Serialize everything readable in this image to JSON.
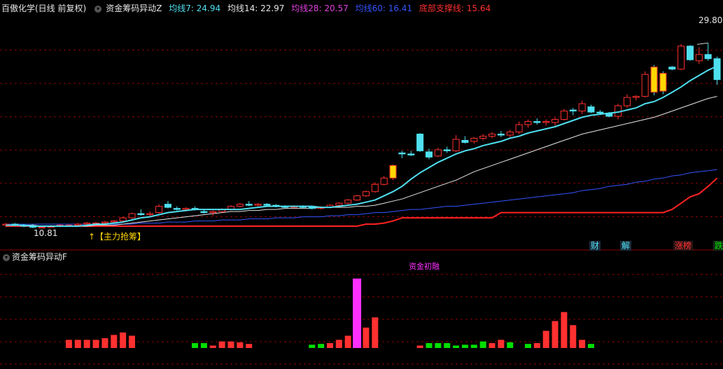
{
  "main_header": {
    "stock": "百傲化学(日线 前复权)",
    "indicator": "资金筹码异动Z",
    "ma7": "均线7: 24.94",
    "ma14": "均线14: 22.97",
    "ma28": "均线28: 20.57",
    "ma60": "均线60: 16.41",
    "support": "底部支撑线: 15.64"
  },
  "sub_header": {
    "indicator": "资金筹码异动F"
  },
  "annotations": {
    "high": "29.80",
    "low": "10.81",
    "main_force": "↑【主力抢筹】",
    "sub_label": "资金初融"
  },
  "tags": [
    "财",
    "解",
    "涨榜",
    "跌"
  ],
  "colors": {
    "ma7": "#4fe0f0",
    "ma14": "#e6e6e6",
    "ma28": "#e040e0",
    "ma60": "#3355ff",
    "support": "#ff2222",
    "up": "#ff3030",
    "down": "#4fe0f0",
    "signal": "#ffd700",
    "green": "#00e000",
    "magenta": "#ff30ff",
    "grid": "#8b0000"
  },
  "chart_data": {
    "type": "candlestick",
    "main_y_range": [
      10.0,
      31.0
    ],
    "candles": [
      [
        11.1,
        11.3,
        10.9,
        11.2
      ],
      [
        11.2,
        11.3,
        11.0,
        11.1
      ],
      [
        11.1,
        11.2,
        10.9,
        11.0
      ],
      [
        11.0,
        11.2,
        10.8,
        10.9
      ],
      [
        10.9,
        11.0,
        10.81,
        10.9
      ],
      [
        10.9,
        11.1,
        10.9,
        11.0
      ],
      [
        11.0,
        11.2,
        10.9,
        11.1
      ],
      [
        11.1,
        11.2,
        11.0,
        11.1
      ],
      [
        11.1,
        11.3,
        11.0,
        11.2
      ],
      [
        11.2,
        11.4,
        11.1,
        11.3
      ],
      [
        11.3,
        11.4,
        11.2,
        11.3
      ],
      [
        11.3,
        11.5,
        11.2,
        11.4
      ],
      [
        11.4,
        11.6,
        11.3,
        11.5
      ],
      [
        11.5,
        11.9,
        11.4,
        11.8
      ],
      [
        11.8,
        12.3,
        11.7,
        12.2
      ],
      [
        12.2,
        12.6,
        12.0,
        12.1
      ],
      [
        12.1,
        12.4,
        11.9,
        12.2
      ],
      [
        12.3,
        13.1,
        12.2,
        12.9
      ],
      [
        13.1,
        13.4,
        12.7,
        12.8
      ],
      [
        12.7,
        12.9,
        12.5,
        12.6
      ],
      [
        12.6,
        12.8,
        12.4,
        12.7
      ],
      [
        12.7,
        12.9,
        12.5,
        12.6
      ],
      [
        12.4,
        12.6,
        12.2,
        12.3
      ],
      [
        12.3,
        12.5,
        12.0,
        12.4
      ],
      [
        12.4,
        12.7,
        12.3,
        12.6
      ],
      [
        12.6,
        13.0,
        12.5,
        12.9
      ],
      [
        12.9,
        13.2,
        12.8,
        13.1
      ],
      [
        13.1,
        13.4,
        12.9,
        13.0
      ],
      [
        13.0,
        13.2,
        12.9,
        13.1
      ],
      [
        13.1,
        13.2,
        12.9,
        13.0
      ],
      [
        13.0,
        13.1,
        12.8,
        12.9
      ],
      [
        12.9,
        13.0,
        12.7,
        12.8
      ],
      [
        12.8,
        13.0,
        12.7,
        12.9
      ],
      [
        12.9,
        13.0,
        12.7,
        12.8
      ],
      [
        12.8,
        12.9,
        12.6,
        12.7
      ],
      [
        12.7,
        12.9,
        12.6,
        12.8
      ],
      [
        12.8,
        13.1,
        12.7,
        13.0
      ],
      [
        13.0,
        13.3,
        12.9,
        13.2
      ],
      [
        13.2,
        13.6,
        13.1,
        13.5
      ],
      [
        13.5,
        14.0,
        13.4,
        13.9
      ],
      [
        13.9,
        14.4,
        13.8,
        14.3
      ],
      [
        14.3,
        15.2,
        14.2,
        15.0
      ],
      [
        15.0,
        15.8,
        14.9,
        15.6
      ],
      [
        15.6,
        16.9,
        15.4,
        16.8
      ],
      [
        18.0,
        18.2,
        17.5,
        17.9
      ],
      [
        17.9,
        18.2,
        17.7,
        17.8
      ],
      [
        19.8,
        19.9,
        18.1,
        18.2
      ],
      [
        18.1,
        18.4,
        17.4,
        17.6
      ],
      [
        17.7,
        18.5,
        17.6,
        18.3
      ],
      [
        18.3,
        18.6,
        18.0,
        18.2
      ],
      [
        18.2,
        19.7,
        18.1,
        19.3
      ],
      [
        19.2,
        19.6,
        18.9,
        19.0
      ],
      [
        19.1,
        19.5,
        18.9,
        19.4
      ],
      [
        19.4,
        19.8,
        19.2,
        19.6
      ],
      [
        19.6,
        20.0,
        19.4,
        19.8
      ],
      [
        19.8,
        20.1,
        19.5,
        19.7
      ],
      [
        19.7,
        20.2,
        19.5,
        20.0
      ],
      [
        20.0,
        21.0,
        19.8,
        20.7
      ],
      [
        20.7,
        21.2,
        20.4,
        21.0
      ],
      [
        21.0,
        21.3,
        20.7,
        20.9
      ],
      [
        20.9,
        21.2,
        20.6,
        21.0
      ],
      [
        20.9,
        21.4,
        20.6,
        21.2
      ],
      [
        21.2,
        22.2,
        21.1,
        22.0
      ],
      [
        22.1,
        22.3,
        21.6,
        22.0
      ],
      [
        22.0,
        23.0,
        21.7,
        22.7
      ],
      [
        22.4,
        22.6,
        21.8,
        21.9
      ],
      [
        21.9,
        22.1,
        21.7,
        21.8
      ],
      [
        21.8,
        21.9,
        21.4,
        21.5
      ],
      [
        21.5,
        22.7,
        21.2,
        22.5
      ],
      [
        22.5,
        23.6,
        22.3,
        23.3
      ],
      [
        23.3,
        23.5,
        23.0,
        23.4
      ],
      [
        23.4,
        25.8,
        23.3,
        25.5
      ],
      [
        26.2,
        26.4,
        23.5,
        23.8
      ],
      [
        25.6,
        25.8,
        23.6,
        23.9
      ],
      [
        26.2,
        26.3,
        25.9,
        26.0
      ],
      [
        26.0,
        28.4,
        25.9,
        28.2
      ],
      [
        28.2,
        28.3,
        26.8,
        26.9
      ],
      [
        26.8,
        28.1,
        26.5,
        27.4
      ],
      [
        27.4,
        28.5,
        26.8,
        27.0
      ],
      [
        27.0,
        27.2,
        24.5,
        25.0
      ]
    ],
    "ma7": [
      11.1,
      11.1,
      11.1,
      11.0,
      11.0,
      11.0,
      11.0,
      11.0,
      11.0,
      11.1,
      11.2,
      11.2,
      11.3,
      11.4,
      11.6,
      11.8,
      11.9,
      12.1,
      12.3,
      12.4,
      12.5,
      12.6,
      12.6,
      12.6,
      12.6,
      12.6,
      12.6,
      12.7,
      12.8,
      12.9,
      12.9,
      12.9,
      12.9,
      12.9,
      12.9,
      12.8,
      12.8,
      12.9,
      13.0,
      13.1,
      13.3,
      13.5,
      13.9,
      14.3,
      14.8,
      15.5,
      16.1,
      16.6,
      17.1,
      17.5,
      17.9,
      18.2,
      18.4,
      18.7,
      18.9,
      19.1,
      19.4,
      19.6,
      19.9,
      20.1,
      20.3,
      20.5,
      20.8,
      21.1,
      21.4,
      21.6,
      21.7,
      21.8,
      21.9,
      22.1,
      22.3,
      22.7,
      22.9,
      23.3,
      23.8,
      24.3,
      24.9,
      25.4,
      25.9,
      26.3
    ],
    "ma14": [
      11.1,
      11.1,
      11.1,
      11.1,
      11.0,
      11.0,
      11.0,
      11.0,
      11.0,
      11.0,
      11.1,
      11.1,
      11.1,
      11.2,
      11.3,
      11.4,
      11.5,
      11.6,
      11.7,
      11.8,
      11.9,
      12.0,
      12.1,
      12.2,
      12.3,
      12.4,
      12.4,
      12.5,
      12.5,
      12.6,
      12.6,
      12.7,
      12.7,
      12.7,
      12.7,
      12.8,
      12.8,
      12.8,
      12.8,
      12.9,
      12.9,
      13.0,
      13.2,
      13.4,
      13.6,
      13.9,
      14.2,
      14.5,
      14.8,
      15.1,
      15.4,
      15.8,
      16.2,
      16.5,
      16.8,
      17.1,
      17.4,
      17.7,
      18.0,
      18.3,
      18.6,
      18.9,
      19.2,
      19.5,
      19.8,
      20.0,
      20.2,
      20.4,
      20.6,
      20.8,
      21.0,
      21.2,
      21.4,
      21.7,
      22.0,
      22.3,
      22.6,
      22.9,
      23.2,
      23.4
    ],
    "ma60": [
      11.2,
      11.2,
      11.2,
      11.2,
      11.2,
      11.2,
      11.2,
      11.2,
      11.2,
      11.2,
      11.2,
      11.2,
      11.2,
      11.2,
      11.2,
      11.3,
      11.3,
      11.3,
      11.4,
      11.4,
      11.4,
      11.5,
      11.5,
      11.5,
      11.6,
      11.6,
      11.6,
      11.7,
      11.7,
      11.7,
      11.8,
      11.8,
      11.8,
      11.9,
      11.9,
      11.9,
      12.0,
      12.0,
      12.1,
      12.1,
      12.2,
      12.3,
      12.3,
      12.4,
      12.5,
      12.6,
      12.6,
      12.7,
      12.8,
      12.9,
      12.9,
      13.0,
      13.1,
      13.2,
      13.3,
      13.4,
      13.5,
      13.6,
      13.7,
      13.8,
      13.9,
      14.0,
      14.1,
      14.2,
      14.4,
      14.5,
      14.6,
      14.8,
      14.9,
      15.0,
      15.2,
      15.3,
      15.5,
      15.6,
      15.8,
      15.9,
      16.1,
      16.2,
      16.3,
      16.4
    ],
    "support": [
      11.0,
      11.0,
      11.0,
      11.0,
      11.0,
      11.0,
      11.0,
      11.0,
      11.0,
      11.0,
      11.0,
      11.0,
      11.0,
      11.0,
      11.0,
      11.0,
      11.0,
      11.0,
      11.0,
      11.0,
      11.0,
      11.0,
      11.0,
      11.0,
      11.0,
      11.0,
      11.0,
      11.0,
      11.0,
      11.0,
      11.0,
      11.0,
      11.0,
      11.0,
      11.0,
      11.0,
      11.0,
      11.0,
      11.0,
      11.0,
      11.2,
      11.2,
      11.3,
      11.5,
      11.8,
      11.8,
      11.8,
      11.8,
      11.8,
      11.8,
      11.8,
      11.8,
      11.8,
      11.8,
      11.8,
      12.3,
      12.3,
      12.3,
      12.3,
      12.3,
      12.3,
      12.3,
      12.3,
      12.3,
      12.3,
      12.3,
      12.3,
      12.3,
      12.3,
      12.3,
      12.3,
      12.3,
      12.3,
      12.3,
      12.6,
      13.2,
      13.8,
      14.1,
      14.8,
      15.6
    ],
    "signal_candles": [
      43,
      72,
      73
    ],
    "sub_bars": [
      [
        7,
        2
      ],
      [
        8,
        2
      ],
      [
        9,
        2
      ],
      [
        10,
        2
      ],
      [
        11,
        2.4
      ],
      [
        12,
        3.2
      ],
      [
        13,
        3.8
      ],
      [
        14,
        3.0
      ],
      [
        21,
        1.2,
        "g"
      ],
      [
        22,
        1.2,
        "g"
      ],
      [
        23,
        0.6
      ],
      [
        24,
        1.6
      ],
      [
        25,
        1.6
      ],
      [
        26,
        1.4
      ],
      [
        27,
        1.0
      ],
      [
        34,
        0.8,
        "g"
      ],
      [
        35,
        1.0,
        "g"
      ],
      [
        36,
        1.2
      ],
      [
        37,
        2.0
      ],
      [
        38,
        3.0
      ],
      [
        39,
        17.0,
        "m"
      ],
      [
        40,
        5.0
      ],
      [
        41,
        7.5
      ],
      [
        46,
        0.6
      ],
      [
        47,
        1.2,
        "g"
      ],
      [
        48,
        1.2,
        "g"
      ],
      [
        49,
        1.2,
        "g"
      ],
      [
        50,
        0.6,
        "g"
      ],
      [
        51,
        0.8,
        "g"
      ],
      [
        52,
        0.8,
        "g"
      ],
      [
        53,
        1.6,
        "g"
      ],
      [
        54,
        1.2
      ],
      [
        55,
        2.0
      ],
      [
        56,
        1.4,
        "g"
      ],
      [
        58,
        1.0,
        "g"
      ],
      [
        59,
        1.2
      ],
      [
        60,
        4.2
      ],
      [
        61,
        6.6
      ],
      [
        62,
        8.8
      ],
      [
        63,
        5.6
      ],
      [
        64,
        2.0
      ],
      [
        65,
        1.0,
        "g"
      ]
    ],
    "sub_y_range": [
      0,
      18
    ]
  }
}
